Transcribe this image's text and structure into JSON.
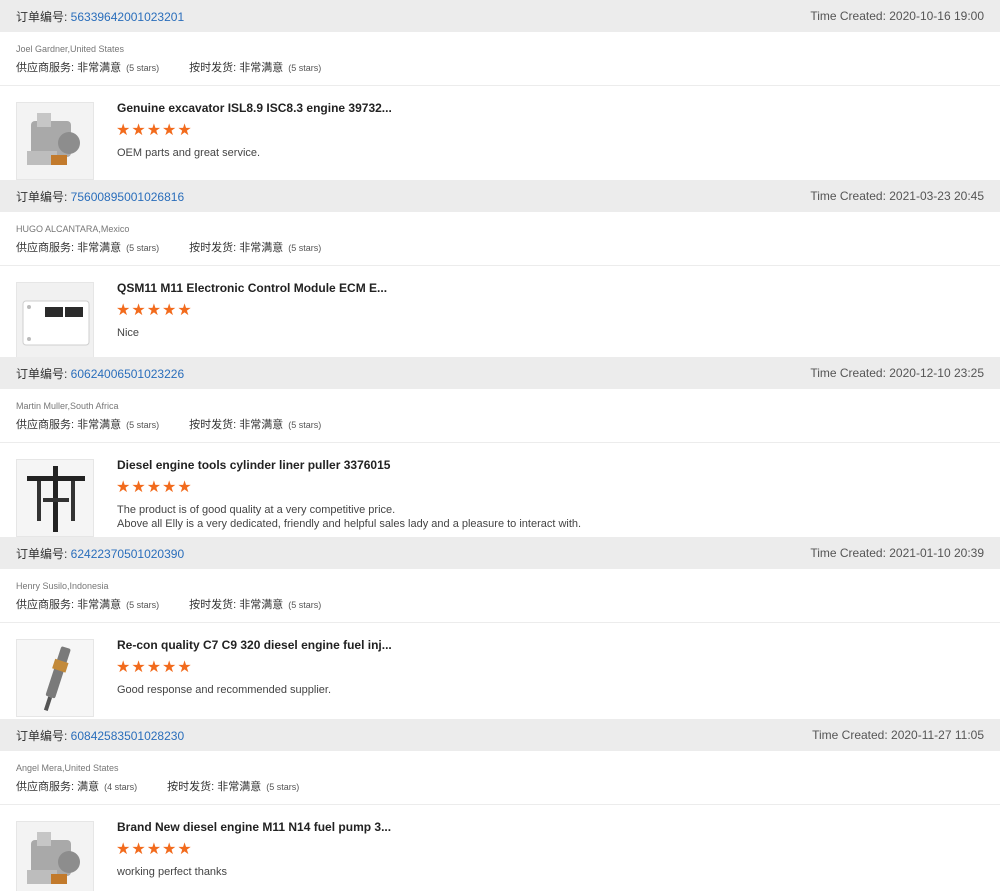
{
  "labels": {
    "order_prefix": "订单编号: ",
    "time_prefix": "Time Created: ",
    "supplier_service": "供应商服务: ",
    "on_time_shipping": "按时发货: "
  },
  "colors": {
    "star": "#f26b1d",
    "order_link": "#2a6ebb",
    "order_bar_bg": "#ececec"
  },
  "reviews": [
    {
      "order_no": "56339642001023201",
      "time_created": "2020-10-16 19:00",
      "buyer": "Joel Gardner,United States",
      "service_rating": "非常满意",
      "service_stars_note": "(5 stars)",
      "shipping_rating": "非常满意",
      "shipping_stars_note": "(5 stars)",
      "product_title": "Genuine excavator ISL8.9 ISC8.3 engine 39732...",
      "product_stars": 5,
      "product_icon": "fuel-pump-image",
      "feedback": [
        "OEM parts and great service."
      ]
    },
    {
      "order_no": "75600895001026816",
      "time_created": "2021-03-23 20:45",
      "buyer": "HUGO ALCANTARA,Mexico",
      "service_rating": "非常满意",
      "service_stars_note": "(5 stars)",
      "shipping_rating": "非常满意",
      "shipping_stars_note": "(5 stars)",
      "product_title": "QSM11 M11 Electronic Control Module ECM E...",
      "product_stars": 5,
      "product_icon": "ecm-module-image",
      "feedback": [
        "Nice"
      ]
    },
    {
      "order_no": "60624006501023226",
      "time_created": "2020-12-10 23:25",
      "buyer": "Martin Muller,South Africa",
      "service_rating": "非常满意",
      "service_stars_note": "(5 stars)",
      "shipping_rating": "非常满意",
      "shipping_stars_note": "(5 stars)",
      "product_title": "Diesel engine tools cylinder liner puller 3376015",
      "product_stars": 5,
      "product_icon": "liner-puller-image",
      "feedback": [
        "The product is of good quality at a very competitive price.",
        "Above all Elly is a very dedicated, friendly and helpful sales lady and a pleasure to interact with."
      ]
    },
    {
      "order_no": "62422370501020390",
      "time_created": "2021-01-10 20:39",
      "buyer": "Henry Susilo,Indonesia",
      "service_rating": "非常满意",
      "service_stars_note": "(5 stars)",
      "shipping_rating": "非常满意",
      "shipping_stars_note": "(5 stars)",
      "product_title": "Re-con quality C7 C9 320 diesel engine fuel inj...",
      "product_stars": 5,
      "product_icon": "fuel-injector-image",
      "feedback": [
        "Good response and recommended supplier."
      ]
    },
    {
      "order_no": "60842583501028230",
      "time_created": "2020-11-27 11:05",
      "buyer": "Angel Mera,United States",
      "service_rating": "满意",
      "service_stars_note": "(4 stars)",
      "shipping_rating": "非常满意",
      "shipping_stars_note": "(5 stars)",
      "product_title": "Brand New diesel engine M11 N14 fuel pump 3...",
      "product_stars": 5,
      "product_icon": "fuel-pump-image",
      "feedback": [
        "working perfect thanks"
      ]
    }
  ]
}
